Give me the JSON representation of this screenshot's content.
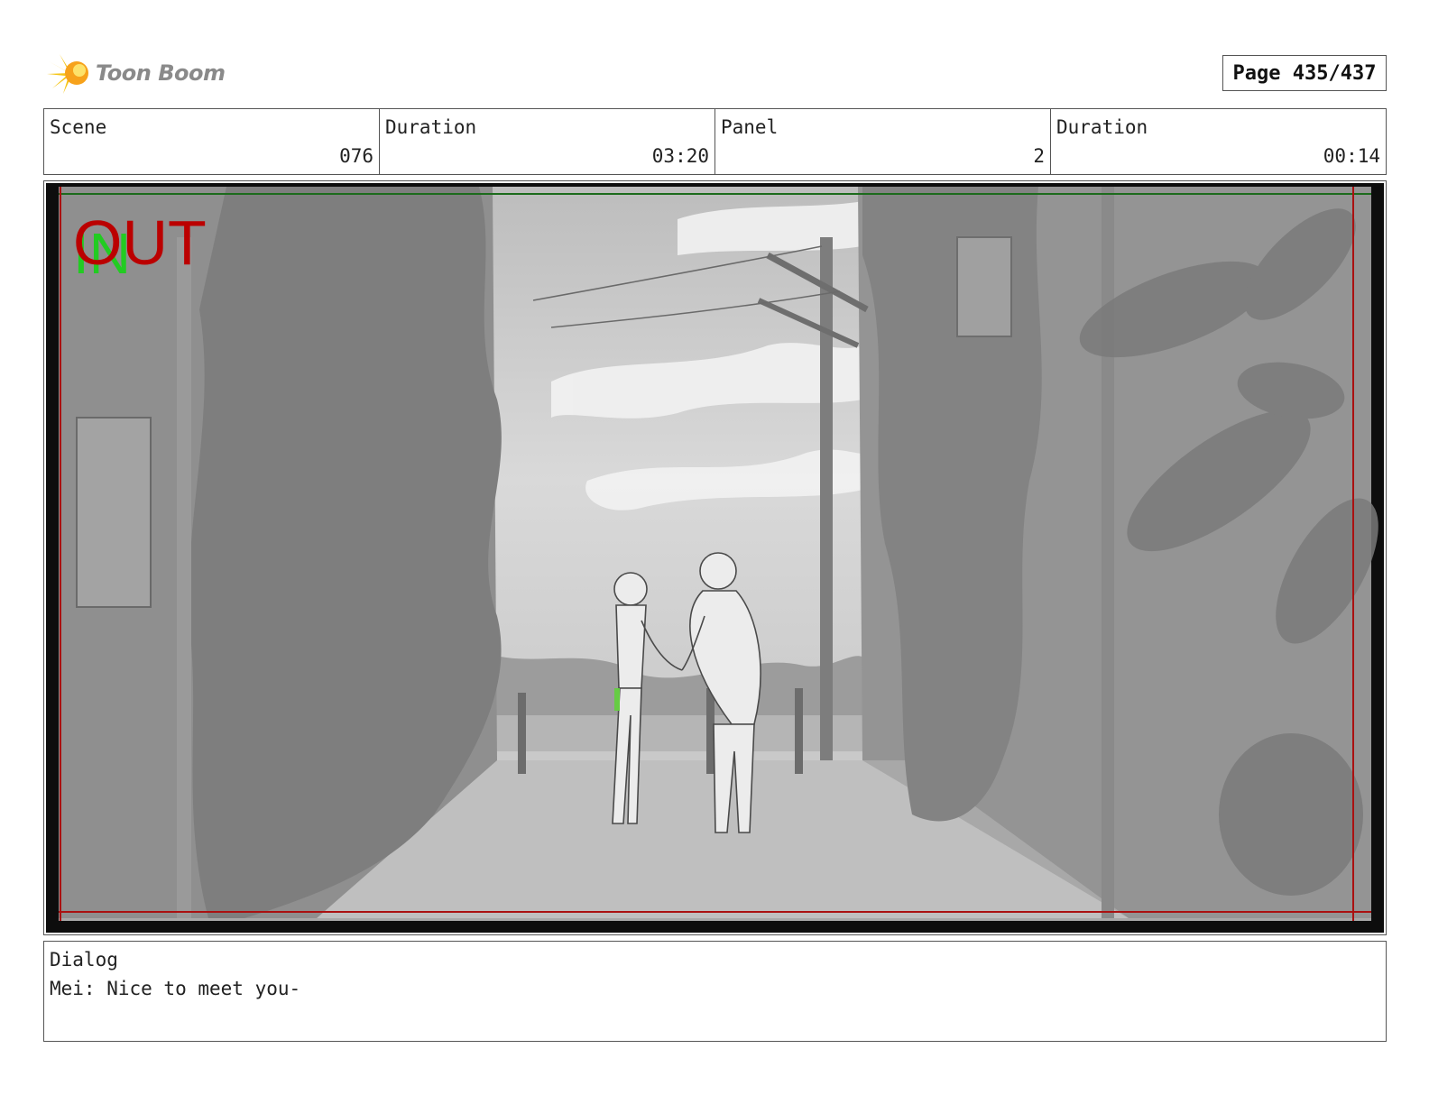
{
  "header": {
    "logo_text": "Toon Boom",
    "logo_icon": "sun-burst-icon",
    "page_label": "Page 435/437"
  },
  "info": {
    "scene_label": "Scene",
    "scene_value": "076",
    "scene_duration_label": "Duration",
    "scene_duration_value": "03:20",
    "panel_label": "Panel",
    "panel_value": "2",
    "panel_duration_label": "Duration",
    "panel_duration_value": "00:14"
  },
  "frame": {
    "in_label": "IN",
    "out_label": "OUT",
    "in_color": "#22cc22",
    "out_color": "#bb0000"
  },
  "dialog": {
    "label": "Dialog",
    "text": "Mei: Nice to meet you-"
  }
}
